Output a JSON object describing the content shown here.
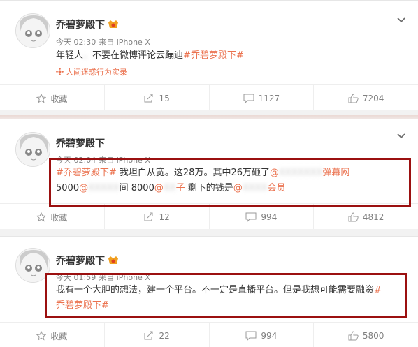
{
  "posts": [
    {
      "author": "乔碧萝殿下",
      "time": "今天 02:30",
      "via": "来自 iPhone X",
      "content_pre": "年轻人",
      "content_blur": "。",
      "content_mid": "不要在微博评论云蹦迪",
      "tag": "#乔碧萝殿下#",
      "source": "人间迷惑行为实录",
      "actions": {
        "fav": "收藏",
        "repost": "15",
        "comment": "1127",
        "like": "7204"
      }
    },
    {
      "author": "乔碧萝殿下",
      "time": "今天 02:04",
      "via": "来自 iPhone X",
      "tag": "#乔碧萝殿下#",
      "line1_text": " 我坦白从宽。这28万。其中26万砸了",
      "mention1": "@",
      "blur1": "XXXXXXX",
      "mention1_tail": "弹幕网",
      "amount1": " 5000",
      "mention2": "@",
      "blur2": "XXXXX",
      "line2_tail": "间 8000",
      "mention3": "@",
      "blur3": "XX",
      "mention3_tail": "子",
      "line2_rest": " 剩下的钱是",
      "mention4": "@",
      "blur4": "XXXX",
      "mention4_tail": "会员",
      "actions": {
        "fav": "收藏",
        "repost": "12",
        "comment": "994",
        "like": "4812"
      }
    },
    {
      "author": "乔碧萝殿下",
      "time": "今天 01:59",
      "via": "来自 iPhone X",
      "content": "我有一个大胆的想法，建一个平台。不一定是直播平台。但是我想可能需要融资",
      "tag_a": "#",
      "tag_b": "乔碧萝殿下#",
      "actions": {
        "fav": "收藏",
        "repost": "22",
        "comment": "994",
        "like": "5800"
      }
    }
  ],
  "colors": {
    "accent": "#eb7350",
    "highlight_box": "#9b1010",
    "meta": "#808080"
  },
  "icons": [
    "avatar",
    "vip-icon",
    "chevron-down-icon",
    "star-icon",
    "repost-icon",
    "comment-icon",
    "like-icon",
    "source-icon"
  ]
}
